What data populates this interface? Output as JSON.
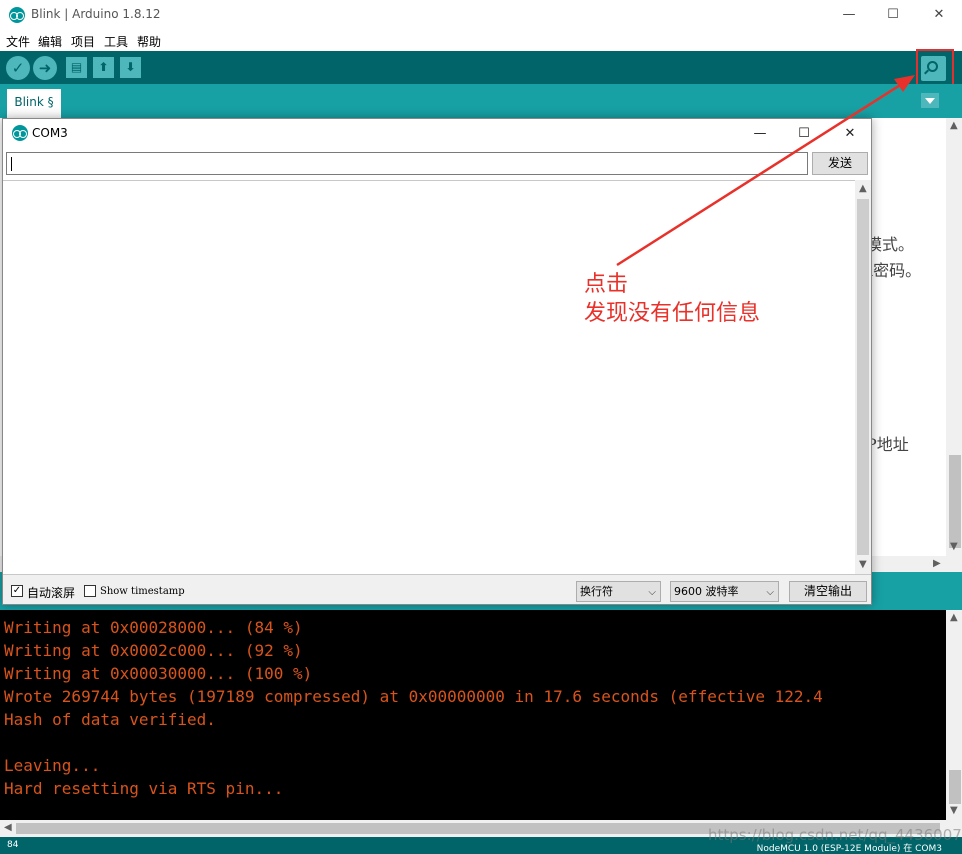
{
  "window": {
    "title": "Blink | Arduino 1.8.12",
    "minimize": "—",
    "maximize": "☐",
    "close": "✕"
  },
  "menu": [
    "文件",
    "编辑",
    "项目",
    "工具",
    "帮助"
  ],
  "toolbar": {
    "verify_icon": "check-icon",
    "upload_icon": "arrow-right-icon",
    "new_icon": "new-file-icon",
    "open_icon": "open-icon",
    "save_icon": "save-icon",
    "serial_monitor_icon": "magnifier-icon"
  },
  "tab": {
    "label": "Blink §"
  },
  "editor_fragments": [
    "模式。",
    "i密码。",
    "P地址"
  ],
  "serial_monitor": {
    "title": "COM3",
    "input_value": "",
    "send_label": "发送",
    "autoscroll_label": "自动滚屏",
    "autoscroll_checked": true,
    "timestamp_label": "Show timestamp",
    "timestamp_checked": false,
    "line_ending": "换行符",
    "baud_rate": "9600 波特率",
    "clear_label": "清空输出"
  },
  "console_lines": [
    "Writing at 0x00028000... (84 %)",
    "Writing at 0x0002c000... (92 %)",
    "Writing at 0x00030000... (100 %)",
    "Wrote 269744 bytes (197189 compressed) at 0x00000000 in 17.6 seconds (effective 122.4",
    "Hash of data verified.",
    "",
    "Leaving...",
    "Hard resetting via RTS pin..."
  ],
  "status": {
    "line_number": "84",
    "board": "NodeMCU 1.0 (ESP-12E Module) 在 COM3"
  },
  "annotation": {
    "line1": "点击",
    "line2": "发现没有任何信息",
    "color": "#e8312a"
  },
  "watermark": "https://blog.csdn.net/qq_44360071",
  "colors": {
    "toolbar": "#006468",
    "tabbar": "#17a1a5",
    "console_text": "#d9541c"
  }
}
